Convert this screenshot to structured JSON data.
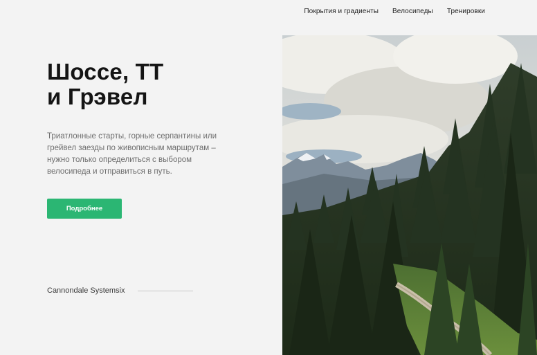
{
  "nav": {
    "items": [
      "Покрытия и градиенты",
      "Велосипеды",
      "Тренировки"
    ]
  },
  "hero": {
    "title_line1": "Шоссе, ТТ",
    "title_line2": "и Грэвел",
    "description": "Триатлонные старты, горные серпантины или грейвел заезды по живописным маршрутам – нужно только определиться с выбором велосипеда и отправиться в путь.",
    "button_label": "Подробнее",
    "caption": "Cannondale Systemsix"
  },
  "colors": {
    "accent": "#2bb673",
    "background": "#f3f3f3"
  }
}
